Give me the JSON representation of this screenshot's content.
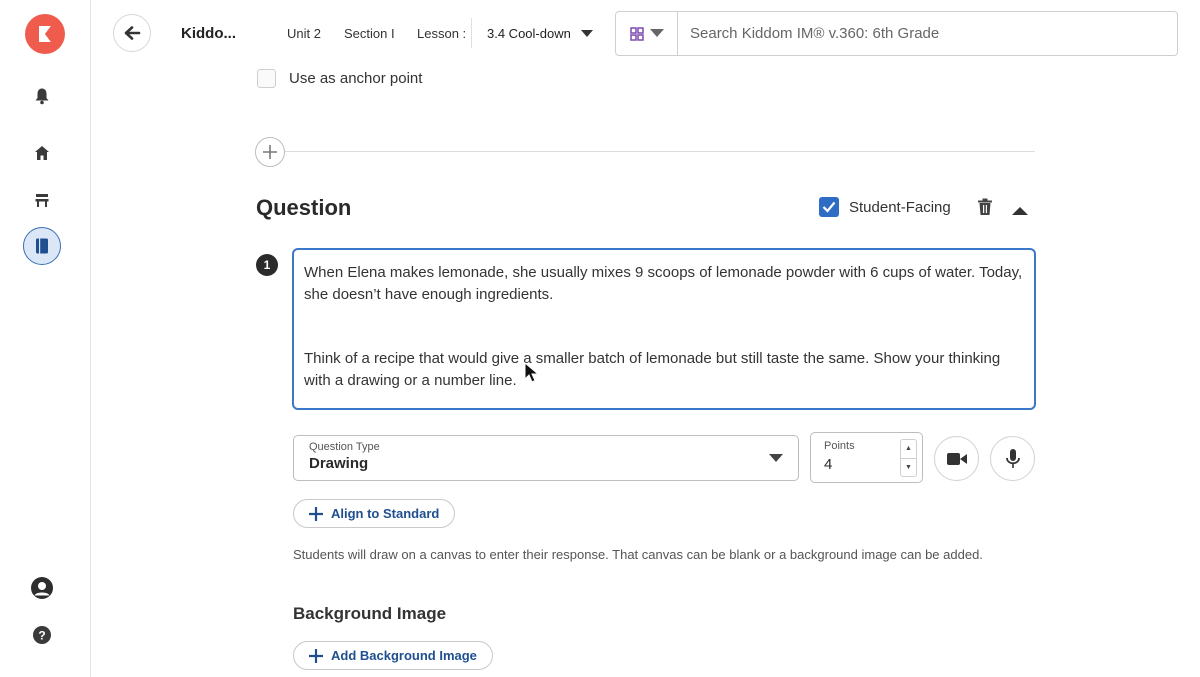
{
  "sidebar": {
    "logo_icon": "kiddom-logo-icon",
    "items": [
      {
        "name": "bell-icon"
      },
      {
        "name": "home-icon"
      },
      {
        "name": "classroom-desk-icon"
      },
      {
        "name": "book-icon",
        "active": true
      }
    ],
    "bottom": [
      {
        "name": "profile-icon"
      },
      {
        "name": "help-icon"
      }
    ]
  },
  "header": {
    "title": "Kiddo...",
    "unit": "Unit 2",
    "section": "Section I",
    "lesson": "Lesson :",
    "activity": "3.4 Cool-down",
    "search_placeholder": "Search Kiddom IM® v.360: 6th Grade"
  },
  "anchor": {
    "label": "Use as anchor point",
    "checked": false
  },
  "question": {
    "heading": "Question",
    "student_facing_label": "Student-Facing",
    "student_facing_checked": true,
    "number": "1",
    "text_para1": "When Elena makes lemonade, she usually mixes 9 scoops of lemonade powder with 6 cups of water. Today, she doesn’t have enough ingredients.",
    "text_para2": "Think of a recipe that would give a smaller batch of lemonade but still taste the same. Show your thinking with a drawing or a number line."
  },
  "controls": {
    "question_type_label": "Question Type",
    "question_type_value": "Drawing",
    "points_label": "Points",
    "points_value": "4",
    "align_button": "Align to Standard",
    "helper_text": "Students will draw on a canvas to enter their response. That canvas can be blank or a background image can be added.",
    "background_heading": "Background Image",
    "add_background_button": "Add Background Image"
  },
  "colors": {
    "brand": "#ef5b4c",
    "accent": "#2f6dc5",
    "link": "#1f4f8f"
  }
}
